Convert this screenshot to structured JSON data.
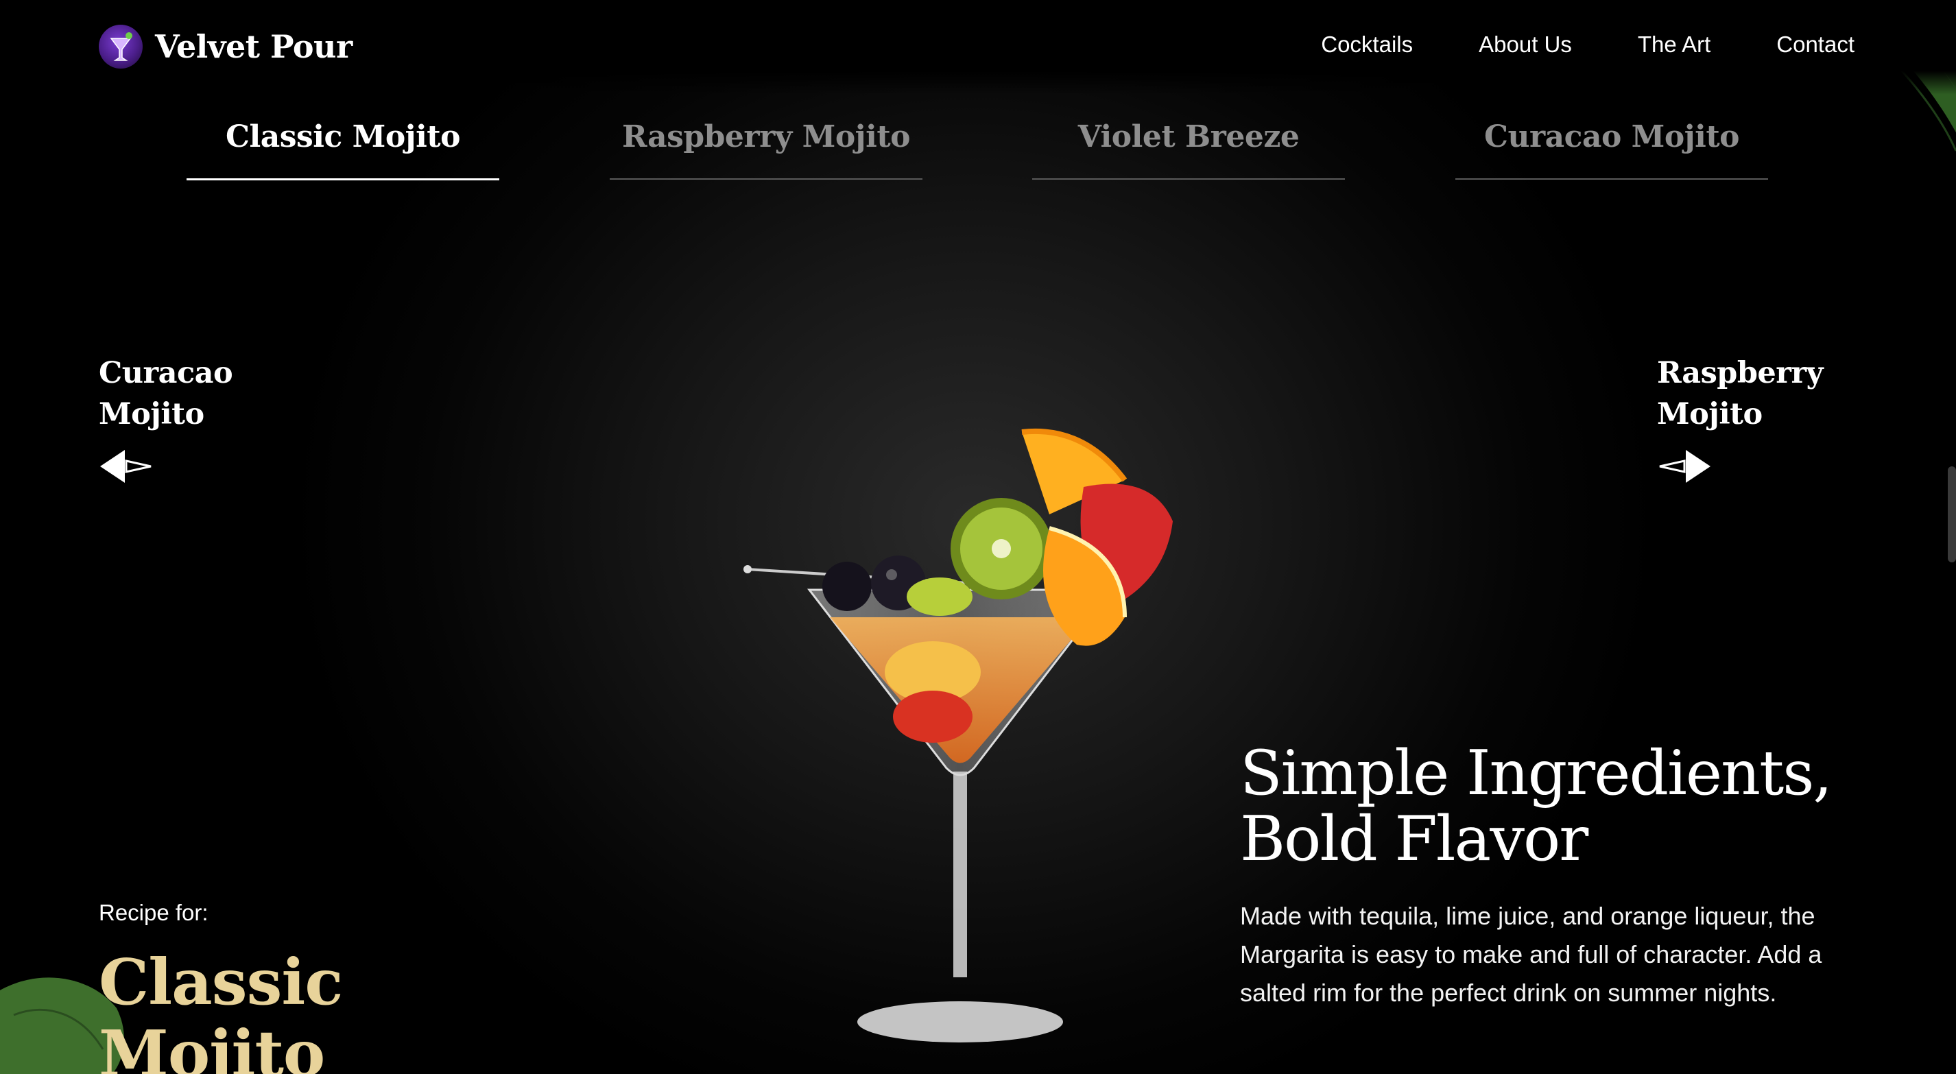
{
  "brand": {
    "name": "Velvet Pour",
    "logo_icon": "cocktail-glass-icon"
  },
  "nav": {
    "items": [
      "Cocktails",
      "About Us",
      "The Art",
      "Contact"
    ]
  },
  "tabs": [
    {
      "label": "Classic Mojito",
      "active": true
    },
    {
      "label": "Raspberry Mojito",
      "active": false
    },
    {
      "label": "Violet Breeze",
      "active": false
    },
    {
      "label": "Curacao Mojito",
      "active": false
    }
  ],
  "prev": {
    "label": "Curacao\nMojito",
    "icon": "arrow-left-icon"
  },
  "next": {
    "label": "Raspberry\nMojito",
    "icon": "arrow-right-icon"
  },
  "feature": {
    "title": "Simple Ingredients, Bold Flavor",
    "body": "Made with tequila, lime juice, and orange liqueur, the Margarita is easy to make and full of character. Add a salted rim for the perfect drink on summer nights."
  },
  "recipe": {
    "label": "Recipe for:",
    "name": "Classic Mojito"
  },
  "colors": {
    "accent": "#e8d39a",
    "background": "#000000",
    "tab_inactive": "#8e8e8e"
  }
}
